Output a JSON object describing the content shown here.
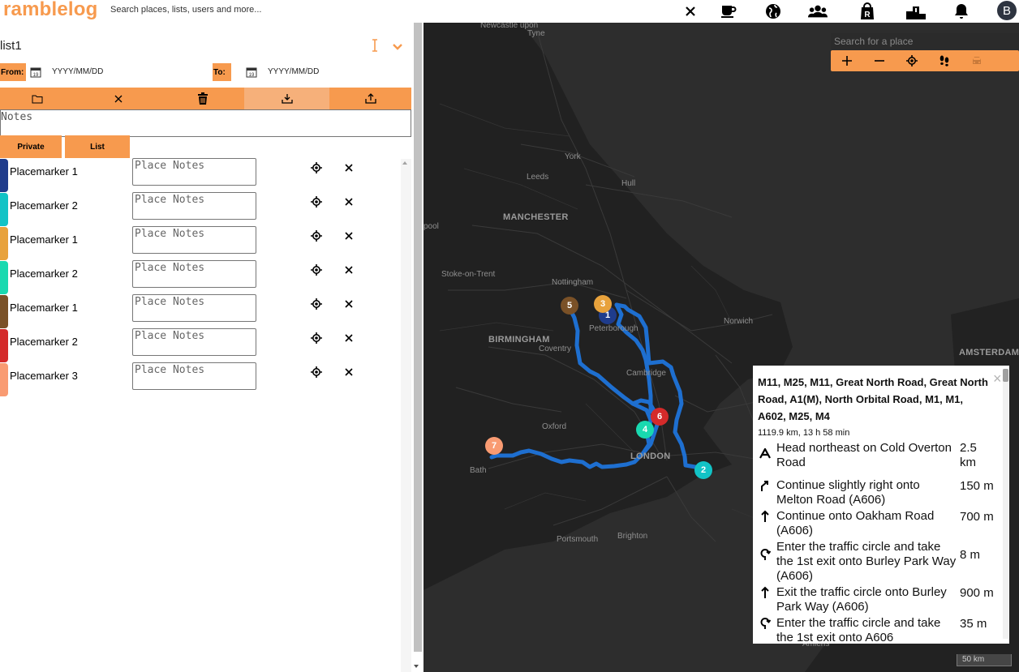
{
  "app": {
    "logo": "ramblelog",
    "search_placeholder": "Search places, lists, users and more...",
    "avatar_letter": "B"
  },
  "topbar_icons": [
    "close-icon",
    "coffee-icon",
    "globe-icon",
    "users-icon",
    "shopping-bag-icon",
    "podium-icon",
    "bell-icon"
  ],
  "list": {
    "name": "list1",
    "from_label": "From:",
    "to_label": "To:",
    "date_placeholder": "YYYY/MM/DD",
    "calendar_day": "19",
    "notes_placeholder": "Notes",
    "tag_private": "Private",
    "tag_list": "List"
  },
  "placemarkers": [
    {
      "label": "Placemarker 1",
      "color": "#1f3c8c",
      "notes_placeholder": "Place Notes"
    },
    {
      "label": "Placemarker 2",
      "color": "#12c3c6",
      "notes_placeholder": "Place Notes"
    },
    {
      "label": "Placemarker 1",
      "color": "#e8a23c",
      "notes_placeholder": "Place Notes"
    },
    {
      "label": "Placemarker 2",
      "color": "#19d9b0",
      "notes_placeholder": "Place Notes"
    },
    {
      "label": "Placemarker 1",
      "color": "#7a5127",
      "notes_placeholder": "Place Notes"
    },
    {
      "label": "Placemarker 2",
      "color": "#d42a2a",
      "notes_placeholder": "Place Notes"
    },
    {
      "label": "Placemarker 3",
      "color": "#f99b72",
      "notes_placeholder": "Place Notes"
    }
  ],
  "map": {
    "search_placeholder": "Search for a place",
    "scale_label": "50 km",
    "route_color": "#1e6fd0",
    "cities": [
      {
        "name": "Newcastle upon",
        "big": false
      },
      {
        "name": "Tyne",
        "big": false
      },
      {
        "name": "York",
        "big": false
      },
      {
        "name": "Leeds",
        "big": false
      },
      {
        "name": "Hull",
        "big": false
      },
      {
        "name": "MANCHESTER",
        "big": true
      },
      {
        "name": "pool",
        "big": false
      },
      {
        "name": "Stoke-on-Trent",
        "big": false
      },
      {
        "name": "Nottingham",
        "big": false
      },
      {
        "name": "Peterborough",
        "big": false
      },
      {
        "name": "Norwich",
        "big": false
      },
      {
        "name": "BIRMINGHAM",
        "big": true
      },
      {
        "name": "Coventry",
        "big": false
      },
      {
        "name": "Cambridge",
        "big": false
      },
      {
        "name": "AMSTERDAM",
        "big": true
      },
      {
        "name": "Oxford",
        "big": false
      },
      {
        "name": "LONDON",
        "big": true
      },
      {
        "name": "Bath",
        "big": false
      },
      {
        "name": "Portsmouth",
        "big": false
      },
      {
        "name": "Brighton",
        "big": false
      },
      {
        "name": "Amiens",
        "big": false
      }
    ],
    "markers": [
      {
        "number": "1",
        "color": "#1f3c8c"
      },
      {
        "number": "2",
        "color": "#12c3c6"
      },
      {
        "number": "3",
        "color": "#e8a23c"
      },
      {
        "number": "4",
        "color": "#19d9b0"
      },
      {
        "number": "5",
        "color": "#7a5127"
      },
      {
        "number": "6",
        "color": "#d42a2a"
      },
      {
        "number": "7",
        "color": "#f99b72"
      }
    ]
  },
  "directions": {
    "title": "M11, M25, M11, Great North Road, Great North Road, A1(M), North Orbital Road, M1, M1, A602, M25, M4",
    "summary": "1119.9 km, 13 h 58 min",
    "steps": [
      {
        "icon": "start-a-icon",
        "text": "Head northeast on Cold Overton Road",
        "distance": "2.5 km"
      },
      {
        "icon": "slight-right-icon",
        "text": "Continue slightly right onto Melton Road (A606)",
        "distance": "150 m"
      },
      {
        "icon": "straight-icon",
        "text": "Continue onto Oakham Road (A606)",
        "distance": "700 m"
      },
      {
        "icon": "roundabout-icon",
        "text": "Enter the traffic circle and take the 1st exit onto Burley Park Way (A606)",
        "distance": "8 m"
      },
      {
        "icon": "straight-icon",
        "text": "Exit the traffic circle onto Burley Park Way (A606)",
        "distance": "900 m"
      },
      {
        "icon": "roundabout-icon",
        "text": "Enter the traffic circle and take the 1st exit onto A606",
        "distance": "35 m"
      }
    ]
  }
}
